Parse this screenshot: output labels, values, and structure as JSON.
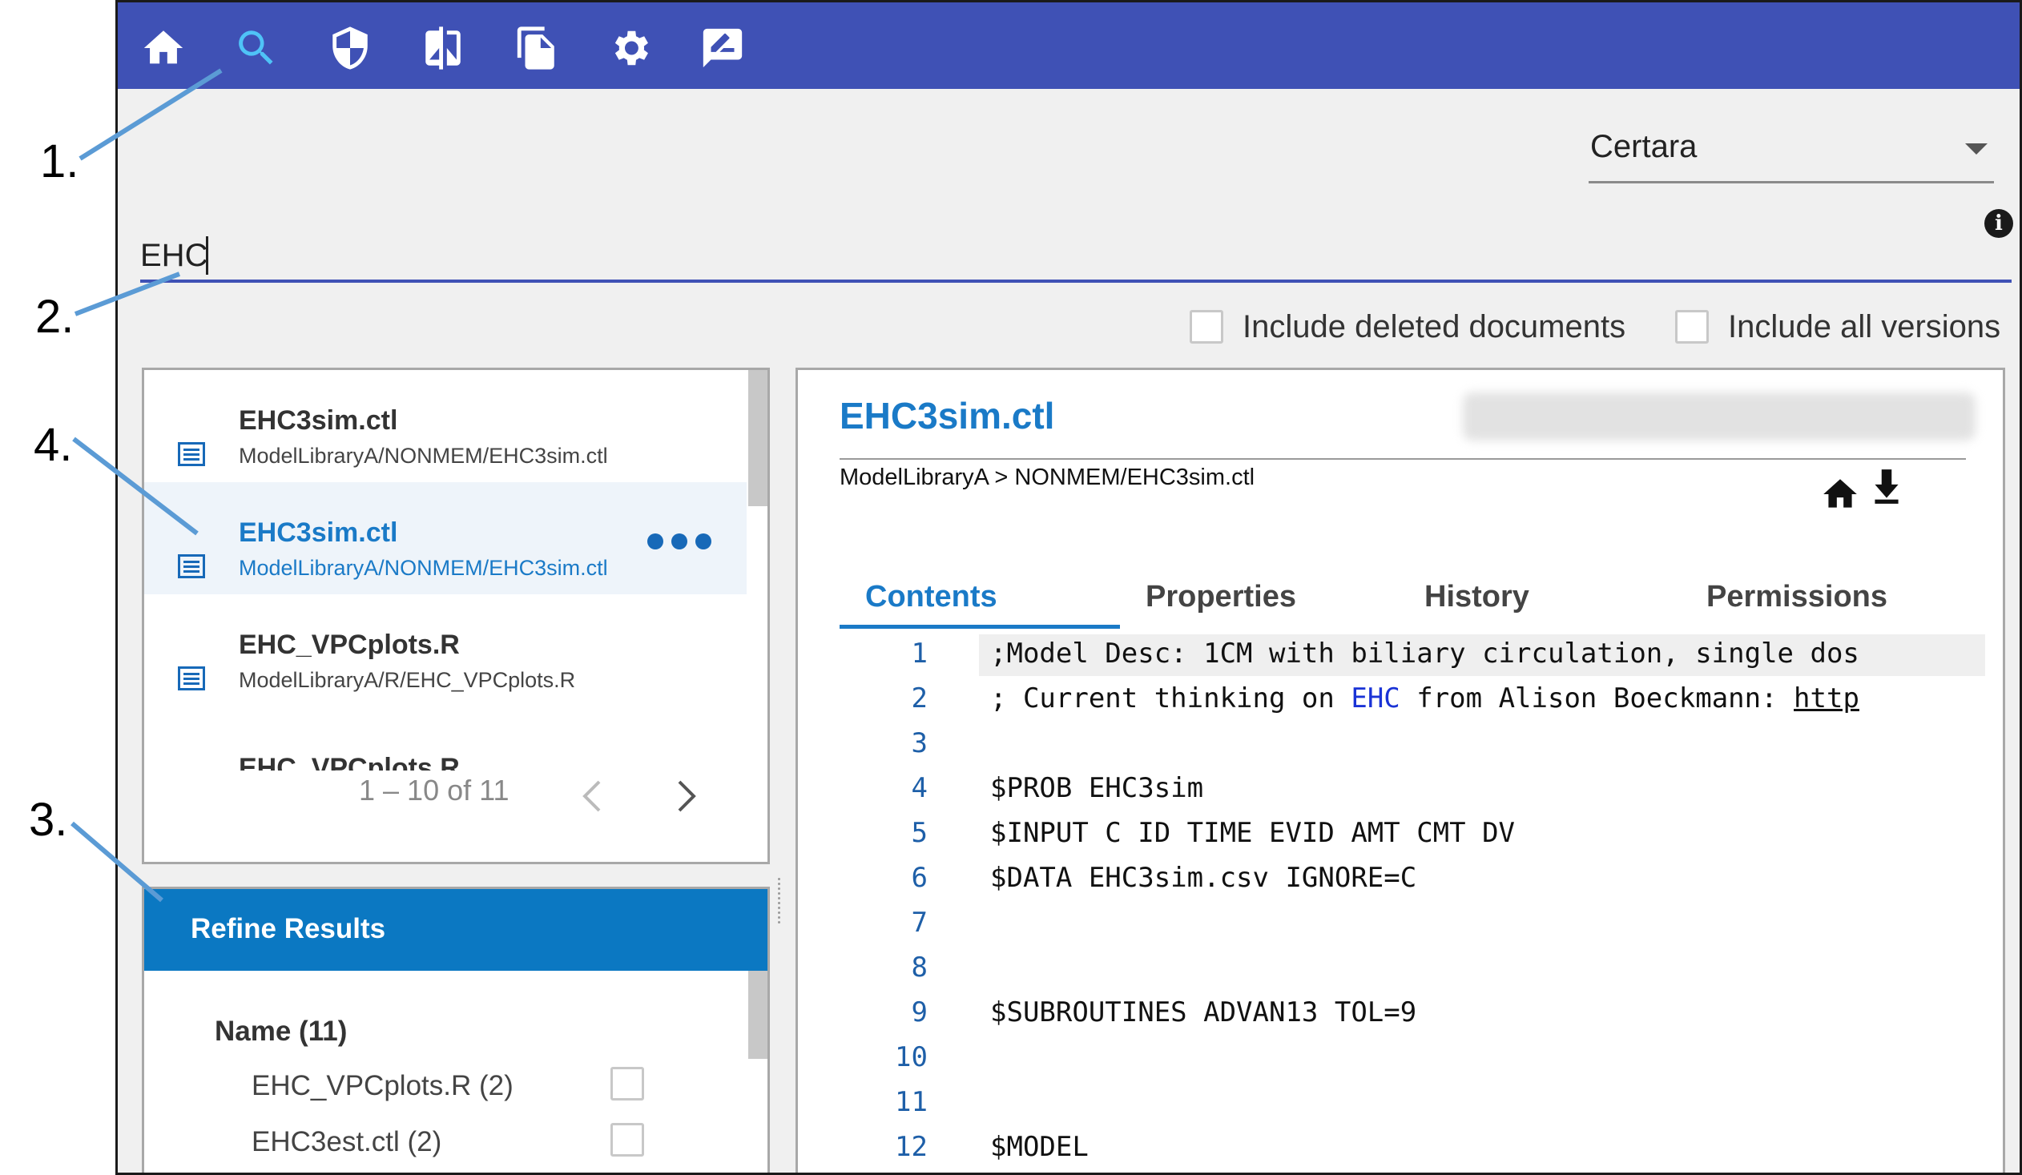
{
  "callouts": [
    "1.",
    "2.",
    "3.",
    "4."
  ],
  "toolbar": {
    "icons": [
      "home-icon",
      "search-icon",
      "shield-icon",
      "compare-icon",
      "documents-icon",
      "gear-icon",
      "signature-icon"
    ],
    "accent": "#3f51b5",
    "active_icon_color": "#4fc3f7"
  },
  "organization": {
    "selected": "Certara"
  },
  "search": {
    "query": "EHC"
  },
  "options": {
    "include_deleted": "Include deleted documents",
    "include_versions": "Include all versions"
  },
  "results": {
    "items": [
      {
        "name": "EHC3sim.ctl",
        "path": "ModelLibraryA/NONMEM/EHC3sim.ctl"
      },
      {
        "name": "EHC3sim.ctl",
        "path": "ModelLibraryA/NONMEM/EHC3sim.ctl"
      },
      {
        "name": "EHC_VPCplots.R",
        "path": "ModelLibraryA/R/EHC_VPCplots.R"
      },
      {
        "name": "EHC_VPCplots.R"
      }
    ],
    "pager": "1 – 10 of 11"
  },
  "refine": {
    "title": "Refine Results",
    "facet_title": "Name (11)",
    "facets": [
      "EHC_VPCplots.R (2)",
      "EHC3est.ctl (2)"
    ]
  },
  "viewer": {
    "title": "EHC3sim.ctl",
    "breadcrumb": "ModelLibraryA > NONMEM/EHC3sim.ctl",
    "tabs": [
      "Contents",
      "Properties",
      "History",
      "Permissions"
    ],
    "active_tab": "Contents",
    "lines": [
      {
        "num": "1",
        "text": ";Model Desc: 1CM with biliary circulation, single dos"
      },
      {
        "num": "2",
        "pre": "; Current thinking on ",
        "kw": "EHC",
        "mid": " from Alison Boeckmann: ",
        "url": "http"
      },
      {
        "num": "3",
        "text": ""
      },
      {
        "num": "4",
        "text": "$PROB EHC3sim"
      },
      {
        "num": "5",
        "text": "$INPUT C ID TIME EVID AMT CMT DV"
      },
      {
        "num": "6",
        "text": "$DATA EHC3sim.csv IGNORE=C"
      },
      {
        "num": "7",
        "text": ""
      },
      {
        "num": "8",
        "text": ""
      },
      {
        "num": "9",
        "text": "$SUBROUTINES ADVAN13 TOL=9"
      },
      {
        "num": "10",
        "text": ""
      },
      {
        "num": "11",
        "text": ""
      },
      {
        "num": "12",
        "text": "$MODEL"
      }
    ]
  }
}
